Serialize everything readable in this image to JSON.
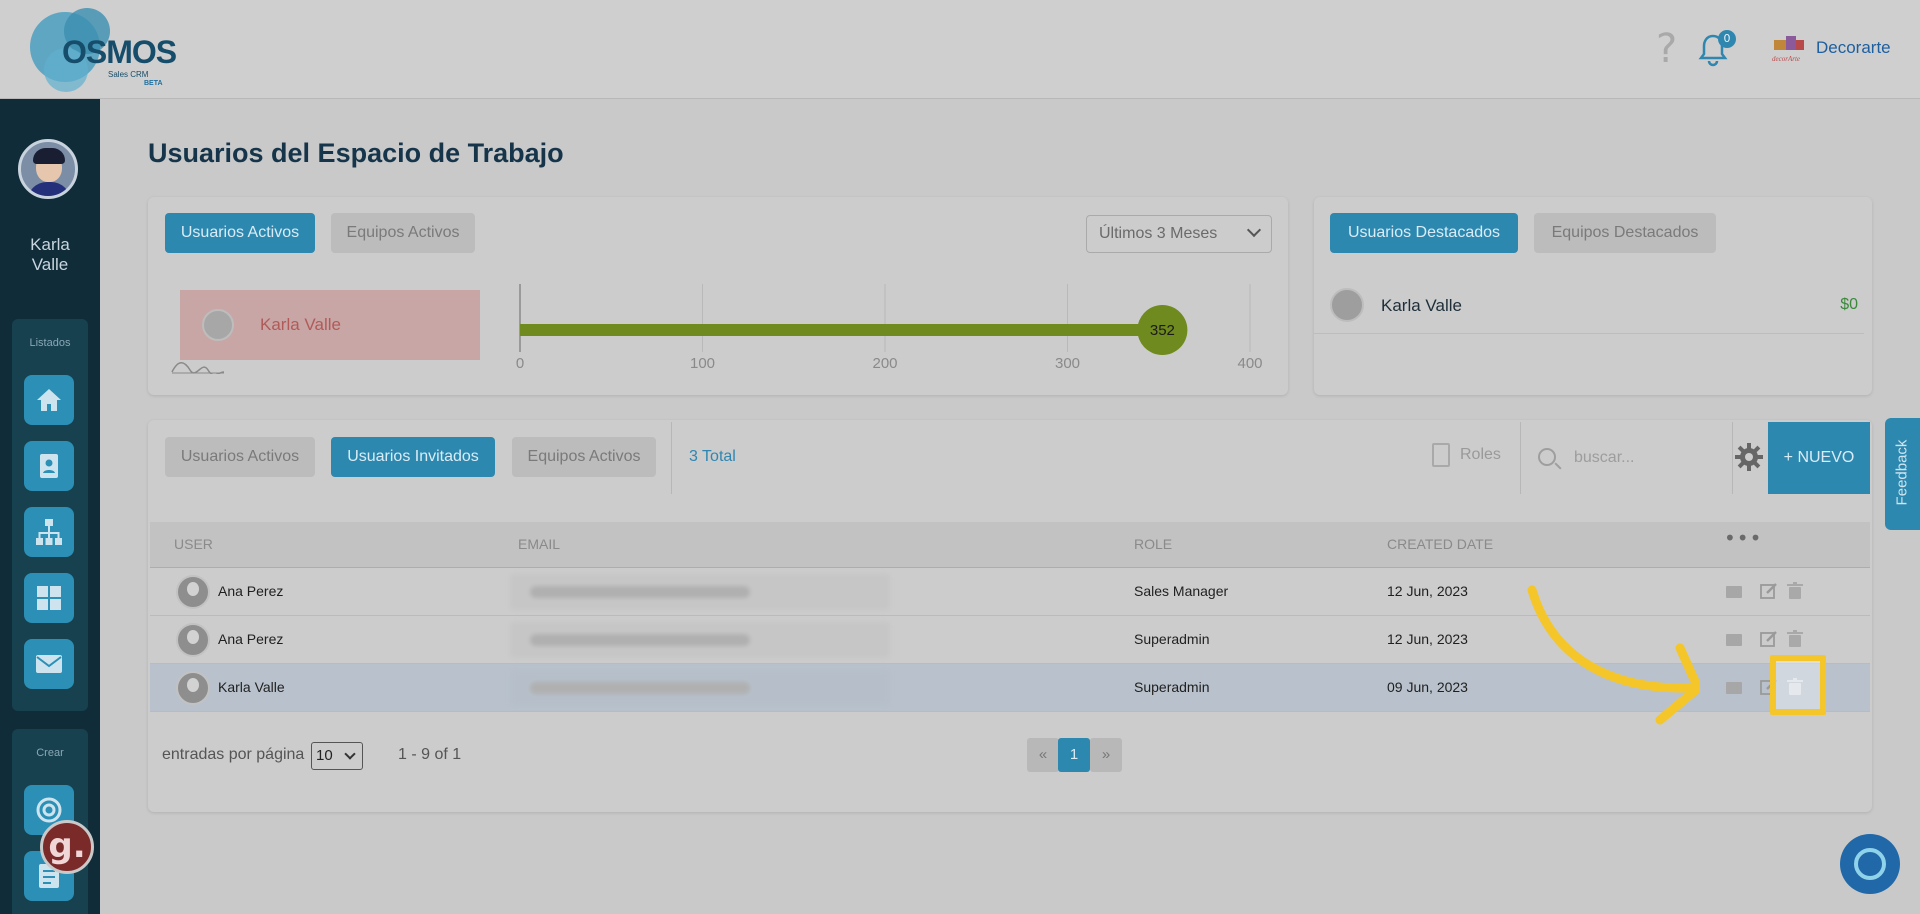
{
  "header": {
    "logo_word": "OSMOS",
    "logo_sub": "Sales CRM",
    "logo_beta": "BETA",
    "help_glyph": "?",
    "notification_count": "0",
    "company_name": "Decorarte"
  },
  "sidebar": {
    "user_name": "Karla Valle",
    "group_listados": "Listados",
    "group_crear": "Crear",
    "items": [
      {
        "icon": "home-icon"
      },
      {
        "icon": "contact-card-icon"
      },
      {
        "icon": "org-chart-icon"
      },
      {
        "icon": "grid-icon"
      },
      {
        "icon": "mail-icon"
      },
      {
        "icon": "target-icon"
      },
      {
        "icon": "checklist-icon"
      }
    ]
  },
  "page": {
    "title": "Usuarios del Espacio de Trabajo"
  },
  "ranking_card": {
    "tab_active": "Usuarios Activos",
    "tab_inactive": "Equipos Activos",
    "period": "Últimos 3 Meses",
    "user_name": "Karla Valle",
    "value_label": "352",
    "ticks": [
      "0",
      "100",
      "200",
      "300",
      "400"
    ]
  },
  "chart_data": {
    "type": "bar",
    "categories": [
      "Karla Valle"
    ],
    "values": [
      352
    ],
    "xlim": [
      0,
      400
    ],
    "ticks": [
      0,
      100,
      200,
      300,
      400
    ],
    "orientation": "horizontal",
    "grid": true
  },
  "featured_card": {
    "tab_active": "Usuarios Destacados",
    "tab_inactive": "Equipos Destacados",
    "user_name": "Karla Valle",
    "amount": "$0"
  },
  "table_card": {
    "tab_activos": "Usuarios Activos",
    "tab_invitados": "Usuarios Invitados",
    "tab_equipos": "Equipos Activos",
    "total": "3 Total",
    "roles_label": "Roles",
    "search_placeholder": "buscar...",
    "new_label": "+ NUEVO",
    "columns": [
      "USER",
      "EMAIL",
      "ROLE",
      "CREATED DATE",
      "•••"
    ],
    "rows": [
      {
        "name": "Ana Perez",
        "role": "Sales Manager",
        "date": "12 Jun, 2023"
      },
      {
        "name": "Ana Perez",
        "role": "Superadmin",
        "date": "12 Jun, 2023"
      },
      {
        "name": "Karla Valle",
        "role": "Superadmin",
        "date": "09 Jun, 2023"
      }
    ],
    "per_page_label": "entradas por página",
    "per_page_value": "10",
    "range_label": "1 - 9 of 1",
    "pager_prev": "«",
    "pager_current": "1",
    "pager_next": "»"
  },
  "feedback_label": "Feedback",
  "g_badge": "g.",
  "colors": {
    "accent": "#2d88b0",
    "sidebar": "#0f2c38",
    "highlight": "#f5c62a",
    "bar": "#6f8a1e"
  }
}
